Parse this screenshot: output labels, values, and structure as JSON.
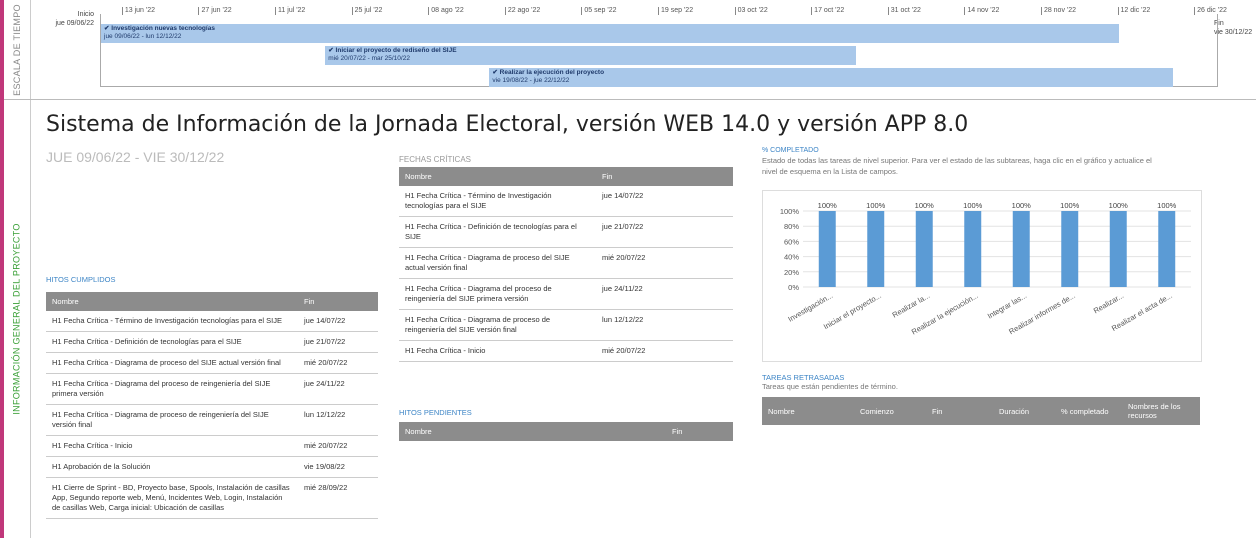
{
  "side_labels": {
    "timescale": "ESCALA DE TIEMPO",
    "project_info": "INFORMACIÓN GENERAL DEL PROYECTO"
  },
  "timeline": {
    "start_label": "Inicio",
    "start_date": "jue 09/06/22",
    "end_label": "Fin",
    "end_date": "vie 30/12/22",
    "ticks": [
      "13 jun '22",
      "27 jun '22",
      "11 jul '22",
      "25 jul '22",
      "08 ago '22",
      "22 ago '22",
      "05 sep '22",
      "19 sep '22",
      "03 oct '22",
      "17 oct '22",
      "31 oct '22",
      "14 nov '22",
      "28 nov '22",
      "12 dic '22",
      "26 dic '22"
    ],
    "bars": [
      {
        "title": "Investigación nuevas tecnologías",
        "dates": "jue 09/06/22 - lun 12/12/22",
        "start": "2022-06-09",
        "end": "2022-12-12",
        "row": 0
      },
      {
        "title": "Iniciar el proyecto de rediseño del SIJE",
        "dates": "mié 20/07/22 - mar 25/10/22",
        "start": "2022-07-20",
        "end": "2022-10-25",
        "row": 1
      },
      {
        "title": "Realizar la ejecución del proyecto",
        "dates": "vie 19/08/22 - jue 22/12/22",
        "start": "2022-08-19",
        "end": "2022-12-22",
        "row": 2
      }
    ]
  },
  "title": "Sistema de Información de la Jornada Electoral, versión WEB 14.0 y versión APP 8.0",
  "date_range": "JUE 09/06/22  - VIE 30/12/22",
  "hitos_cumplidos": {
    "label": "HITOS CUMPLIDOS",
    "headers": [
      "Nombre",
      "Fin"
    ],
    "rows": [
      [
        "H1 Fecha Crítica - Término de Investigación tecnologías para el SIJE",
        "jue 14/07/22"
      ],
      [
        "H1 Fecha Crítica - Definición de tecnologías para el SIJE",
        "jue 21/07/22"
      ],
      [
        "H1 Fecha Crítica - Diagrama de proceso del SIJE actual versión final",
        "mié 20/07/22"
      ],
      [
        "H1 Fecha Crítica - Diagrama del proceso de reingeniería del SIJE primera versión",
        "jue 24/11/22"
      ],
      [
        "H1 Fecha Crítica - Diagrama de proceso de reingeniería del SIJE versión final",
        "lun 12/12/22"
      ],
      [
        "H1 Fecha Crítica - Inicio",
        "mié 20/07/22"
      ],
      [
        "H1 Aprobación de la Solución",
        "vie 19/08/22"
      ],
      [
        "H1 Cierre de Sprint - BD, Proyecto base, Spools, Instalación de casillas App, Segundo reporte web, Menú,  Incidentes Web, Login, Instalación de casillas Web, Carga inicial: Ubicación de casillas",
        "mié 28/09/22"
      ]
    ]
  },
  "fechas_criticas": {
    "label": "FECHAS CRÍTICAS",
    "headers": [
      "Nombre",
      "Fin"
    ],
    "rows": [
      [
        "H1 Fecha Crítica - Término de Investigación tecnologías para el SIJE",
        "jue 14/07/22"
      ],
      [
        "H1 Fecha Crítica - Definición de tecnologías para el SIJE",
        "jue 21/07/22"
      ],
      [
        "H1 Fecha Crítica - Diagrama de proceso del SIJE actual versión final",
        "mié 20/07/22"
      ],
      [
        "H1 Fecha Crítica - Diagrama del proceso de reingeniería del SIJE primera versión",
        "jue 24/11/22"
      ],
      [
        "H1 Fecha Crítica - Diagrama de proceso de reingeniería del SIJE versión final",
        "lun 12/12/22"
      ],
      [
        "H1 Fecha Crítica - Inicio",
        "mié 20/07/22"
      ]
    ]
  },
  "hitos_pendientes": {
    "label": "HITOS PENDIENTES",
    "headers": [
      "Nombre",
      "Fin"
    ]
  },
  "completado": {
    "label": "% COMPLETADO",
    "description": "Estado de todas las tareas de nivel superior. Para ver el estado de las subtareas, haga clic en el gráfico y actualice el nivel de esquema en la Lista de campos."
  },
  "chart_data": {
    "type": "bar",
    "categories": [
      "Investigación...",
      "Iniciar el proyecto...",
      "Realizar la...",
      "Realizar la ejecución...",
      "Integrar las...",
      "Realizar informes de...",
      "Realizar...",
      "Realizar el acta de..."
    ],
    "values": [
      100,
      100,
      100,
      100,
      100,
      100,
      100,
      100
    ],
    "data_labels": [
      "100%",
      "100%",
      "100%",
      "100%",
      "100%",
      "100%",
      "100%",
      "100%"
    ],
    "y_ticks": [
      "0%",
      "20%",
      "40%",
      "60%",
      "80%",
      "100%"
    ],
    "ylim": [
      0,
      100
    ],
    "grid": true,
    "bar_color": "#5b9bd5"
  },
  "tareas_retrasadas": {
    "label": "TAREAS RETRASADAS",
    "description": "Tareas que están pendientes de término.",
    "headers": [
      "Nombre",
      "Comienzo",
      "Fin",
      "Duración",
      "% completado",
      "Nombres de los recursos"
    ]
  },
  "colors": {
    "accent_frame": "#c0377a",
    "section_label": "#3d85c6",
    "side_info": "#3aa037",
    "gantt_bar": "#a9c8ea",
    "table_header": "#8c8c8c"
  }
}
